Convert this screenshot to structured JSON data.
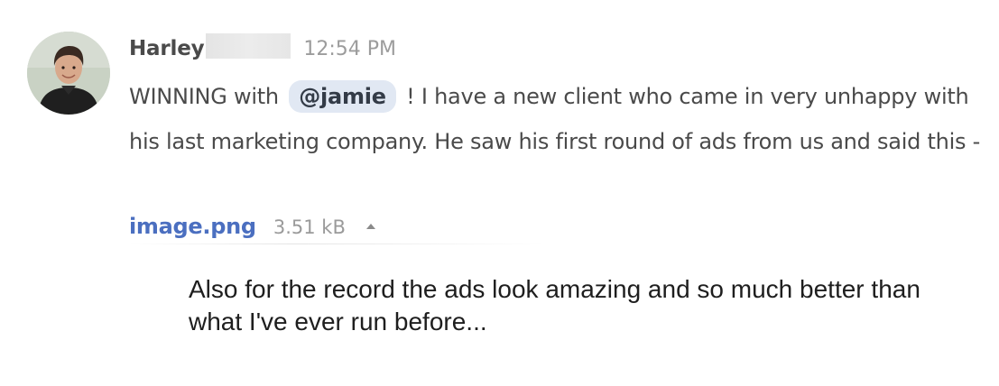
{
  "message": {
    "sender_name": "Harley",
    "timestamp": "12:54 PM",
    "text_before_mention": "WINNING with",
    "mention": "@jamie",
    "text_after_mention": "! I have a new client who came in very unhappy with his last marketing company. He saw his first round of ads from us and said this -"
  },
  "attachment": {
    "file_name": "image.png",
    "file_size": "3.51 kB",
    "toggle_icon": "caret-up-icon"
  },
  "caption": {
    "text": "Also for the record the ads look amazing and so much better than what I've ever run before..."
  },
  "colors": {
    "link": "#4b6fc0",
    "mention_bg": "#e1e8f3",
    "body_text": "#4a4a4a",
    "muted_text": "#9c9c9c"
  }
}
